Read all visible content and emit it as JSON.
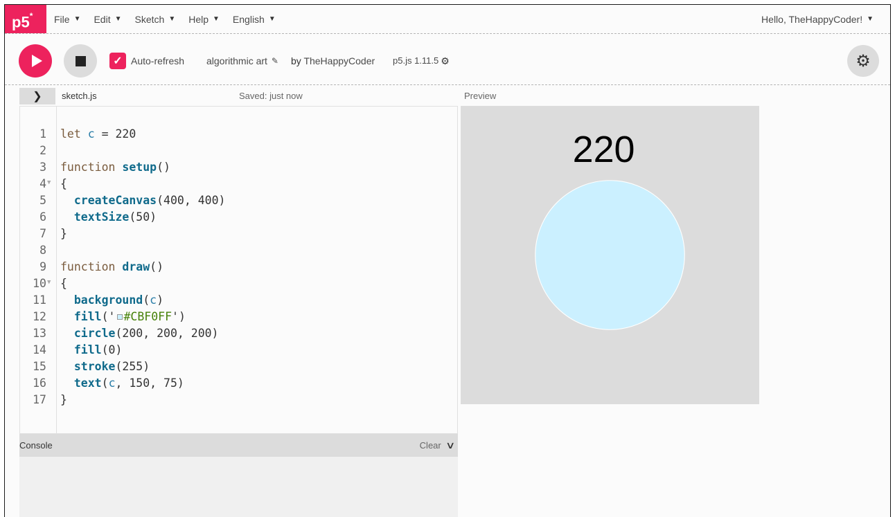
{
  "nav": {
    "logo": "p5",
    "logo_sup": "*",
    "menu": [
      "File",
      "Edit",
      "Sketch",
      "Help",
      "English"
    ],
    "user": "Hello, TheHappyCoder!"
  },
  "toolbar": {
    "auto_refresh_label": "Auto-refresh",
    "auto_refresh_checked": true,
    "project_name": "algorithmic art",
    "by_label": "by",
    "owner": "TheHappyCoder",
    "version": "p5.js 1.11.5"
  },
  "editor": {
    "file_name": "sketch.js",
    "saved_status": "Saved: just now",
    "lines": [
      {
        "n": "1",
        "fold": false
      },
      {
        "n": "2",
        "fold": false
      },
      {
        "n": "3",
        "fold": false
      },
      {
        "n": "4",
        "fold": true
      },
      {
        "n": "5",
        "fold": false
      },
      {
        "n": "6",
        "fold": false
      },
      {
        "n": "7",
        "fold": false
      },
      {
        "n": "8",
        "fold": false
      },
      {
        "n": "9",
        "fold": false
      },
      {
        "n": "10",
        "fold": true
      },
      {
        "n": "11",
        "fold": false
      },
      {
        "n": "12",
        "fold": false
      },
      {
        "n": "13",
        "fold": false
      },
      {
        "n": "14",
        "fold": false
      },
      {
        "n": "15",
        "fold": false
      },
      {
        "n": "16",
        "fold": false
      },
      {
        "n": "17",
        "fold": false
      }
    ],
    "code": {
      "l1_kw": "let",
      "l1_var": "c",
      "l1_rest": " = 220",
      "l3_kw": "function",
      "l3_fn": "setup",
      "l3_rest": "()",
      "l4": "{",
      "l5_fn": "createCanvas",
      "l5_rest": "(400, 400)",
      "l6_fn": "textSize",
      "l6_rest": "(50)",
      "l7": "}",
      "l9_kw": "function",
      "l9_fn": "draw",
      "l9_rest": "()",
      "l10": "{",
      "l11_fn": "background",
      "l11_open": "(",
      "l11_var": "c",
      "l11_close": ")",
      "l12_fn": "fill",
      "l12_open": "('",
      "l12_str": "#CBF0FF",
      "l12_close": "')",
      "l13_fn": "circle",
      "l13_rest": "(200, 200, 200)",
      "l14_fn": "fill",
      "l14_rest": "(0)",
      "l15_fn": "stroke",
      "l15_rest": "(255)",
      "l16_fn": "text",
      "l16_open": "(",
      "l16_var": "c",
      "l16_rest": ", 150, 75)",
      "l17": "}"
    },
    "swatch_color": "#CBF0FF"
  },
  "console": {
    "title": "Console",
    "clear_label": "Clear"
  },
  "preview": {
    "label": "Preview",
    "canvas_text": "220",
    "background_color": "#DCDCDC",
    "circle_color": "#CBF0FF"
  },
  "colors": {
    "accent": "#ED225D"
  }
}
